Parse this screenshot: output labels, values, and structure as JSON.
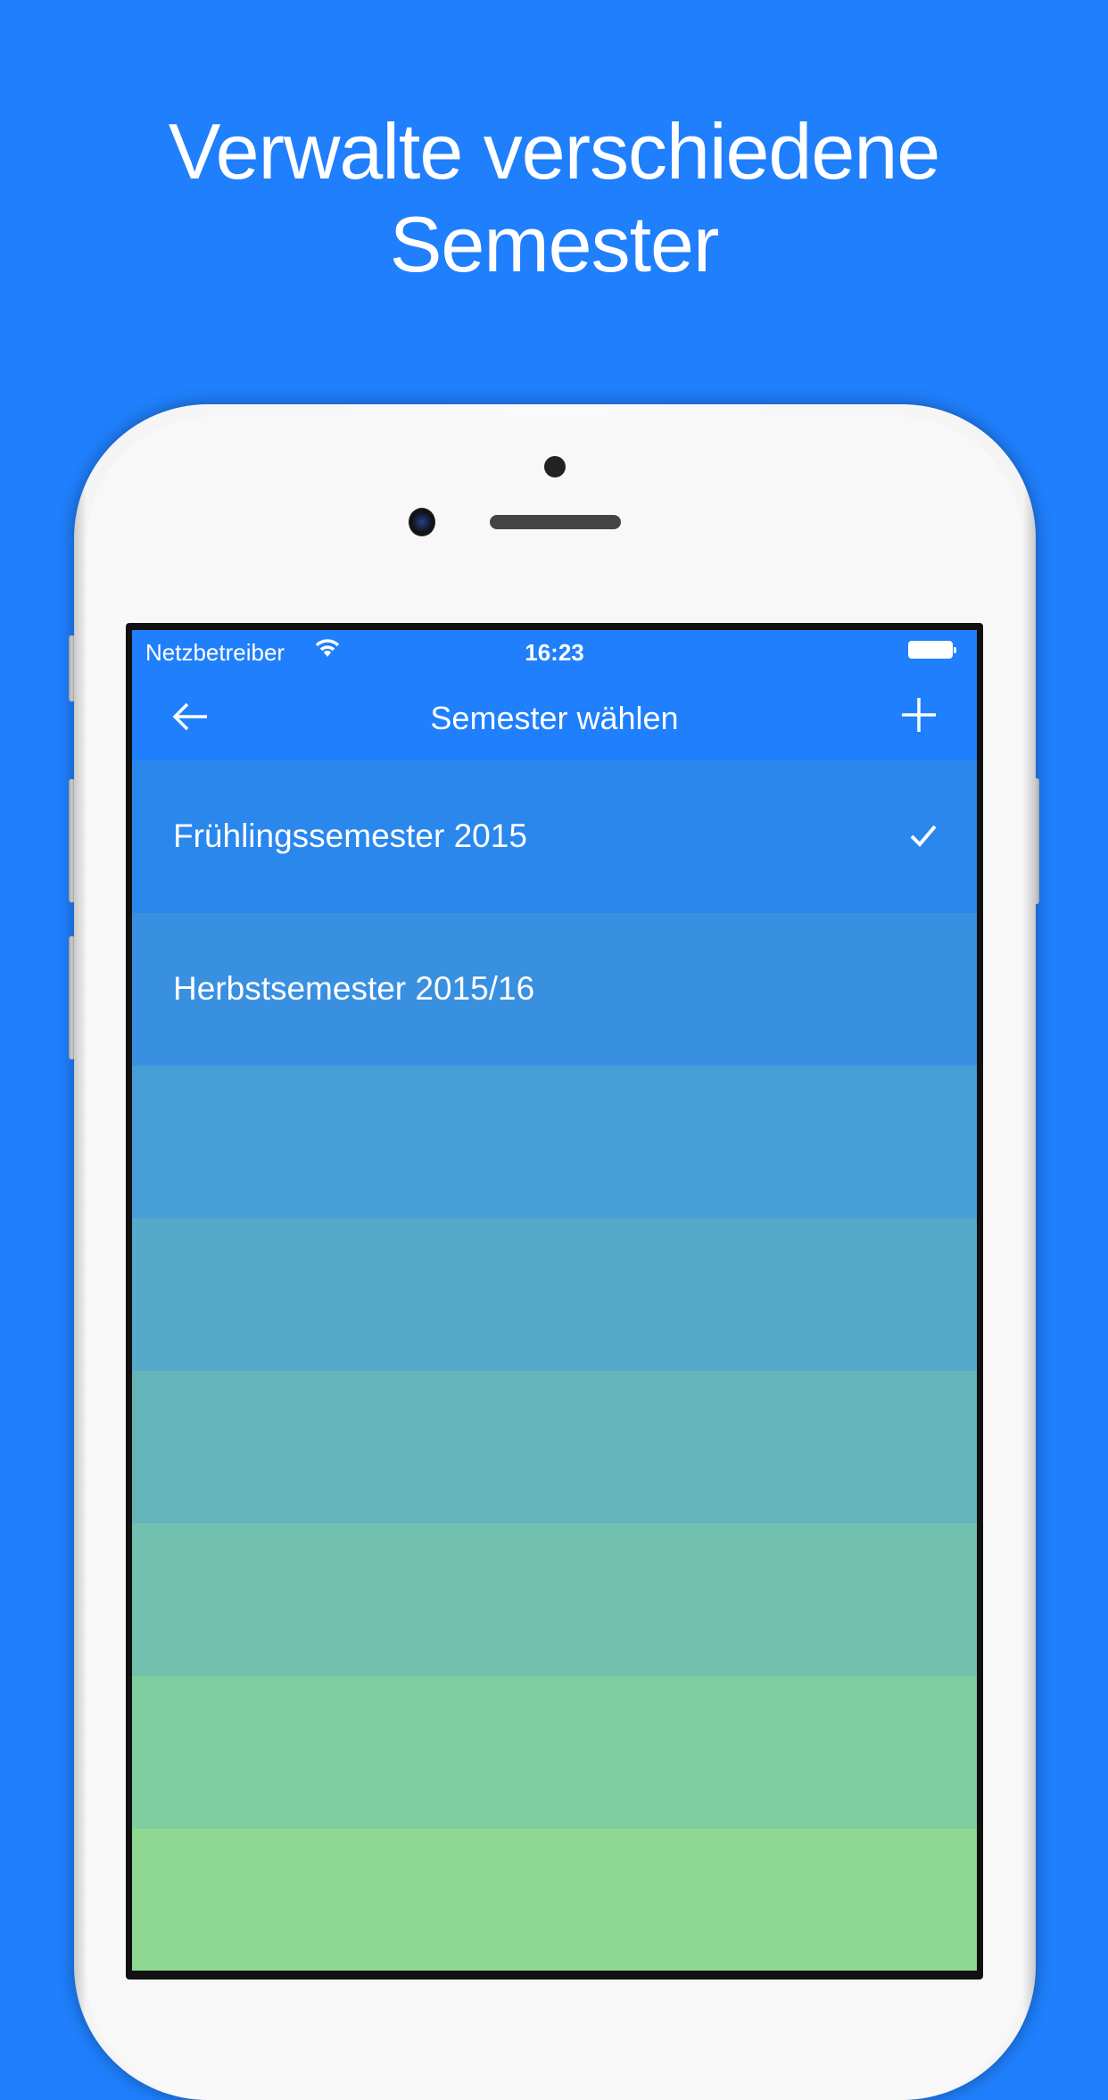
{
  "headline": {
    "line1": "Verwalte verschiedene",
    "line2": "Semester"
  },
  "status_bar": {
    "carrier": "Netzbetreiber",
    "time": "16:23"
  },
  "nav": {
    "title": "Semester wählen",
    "back_icon": "arrow-left-icon",
    "add_icon": "plus-icon"
  },
  "semesters": [
    {
      "label": "Frühlingssemester 2015",
      "selected": true,
      "color": "#2a87ec"
    },
    {
      "label": "Herbstsemester 2015/16",
      "selected": false,
      "color": "#3990e1"
    },
    {
      "label": "",
      "color": "#479ed7"
    },
    {
      "label": "",
      "color": "#55a9c9"
    },
    {
      "label": "",
      "color": "#63b5b9"
    },
    {
      "label": "",
      "color": "#72c1ae"
    },
    {
      "label": "",
      "color": "#80cd9f"
    },
    {
      "label": "",
      "color": "#8ed892"
    }
  ],
  "colors": {
    "background": "#1f7ffc",
    "navbar": "#1f7ffc"
  }
}
